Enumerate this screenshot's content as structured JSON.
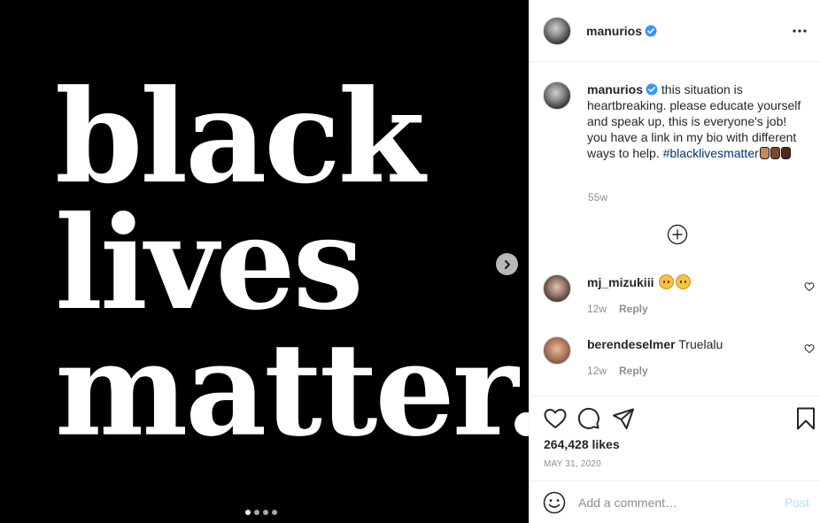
{
  "media": {
    "lines": [
      "black",
      "lives",
      "matter."
    ],
    "carousel_count": 4,
    "carousel_active": 0
  },
  "header": {
    "username": "manurios",
    "more_icon": "more-options-icon"
  },
  "caption": {
    "username": "manurios",
    "text": "this situation is heartbreaking. please educate yourself and speak up, this is everyone's job! you have a link in my bio with different ways to help.",
    "hashtag": "#blacklivesmatter",
    "time": "55w"
  },
  "comments": [
    {
      "username": "mj_mizukiii",
      "text": "",
      "time": "12w",
      "reply": "Reply"
    },
    {
      "username": "berendeselmer",
      "text": "Truelalu",
      "time": "12w",
      "reply": "Reply"
    }
  ],
  "likes": "264,428 likes",
  "date": "May 31, 2020",
  "add_comment": {
    "placeholder": "Add a comment…",
    "post": "Post"
  },
  "colors": {
    "verified": "#3897f0",
    "hashtag": "#00376b",
    "post_disabled": "#b2dffc"
  }
}
